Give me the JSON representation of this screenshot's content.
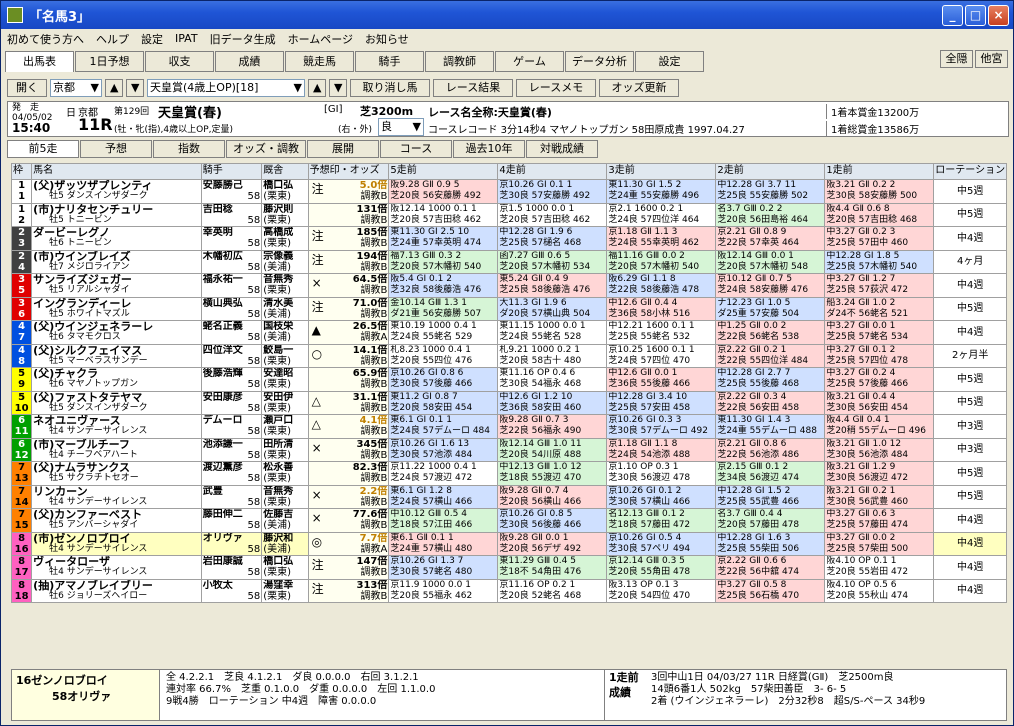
{
  "window": {
    "title": "「名馬3」",
    "controls": [
      "_",
      "□",
      "×"
    ]
  },
  "menu": [
    "初めて使う方へ",
    "ヘルプ",
    "設定",
    "IPAT",
    "旧データ生成",
    "ホームページ",
    "お知らせ"
  ],
  "main_tabs": [
    "出馬表",
    "1日予想",
    "収支",
    "成績",
    "競走馬",
    "騎手",
    "調教師",
    "ゲーム",
    "データ分析",
    "設定"
  ],
  "right_buttons": [
    "全隠",
    "他宮"
  ],
  "controls": {
    "open": "開く",
    "track": "京都",
    "race_select": "天皇賞(4歳上OP)[18]",
    "buttons": [
      "取り消し馬",
      "レース結果",
      "レースメモ",
      "オッズ更新"
    ]
  },
  "race_info": {
    "post_label": "発　走",
    "date": "04/05/02",
    "time": "15:40",
    "day": "日",
    "venue": "京都",
    "round": "11R",
    "meet_no": "第129回",
    "race_name": "天皇賞(春)",
    "conditions": "(牡・牝(指),4歳以上OP,定量)",
    "grade": "[GⅠ]",
    "course": "芝3200m",
    "direction": "(右・外)",
    "going": "良",
    "full_name": "レース名全称:天皇賞(春)",
    "record": "コースレコード 3分14秒4 マヤノトップガン 58田原成貴 1997.04.27",
    "prize1": "1着本賞金13200万",
    "prize2": "1着総賞金13586万"
  },
  "sub_tabs": [
    "前5走",
    "予想",
    "指数",
    "オッズ・調教",
    "展開",
    "コース",
    "過去10年",
    "対戦成績"
  ],
  "headers": [
    "枠",
    "馬名",
    "騎手",
    "厩舎",
    "予想印・オッズ",
    "5走前",
    "4走前",
    "3走前",
    "2走前",
    "1走前",
    "ローテーション"
  ],
  "horses": [
    {
      "waku": "1",
      "no": "1",
      "name": "(父)ザッツザプレンティ",
      "sub": "牡5 ダンスインザダーク",
      "jockey": "安藤勝己",
      "jw": "58",
      "trainer": "橋口弘",
      "loc": "(栗東)",
      "mark": "注",
      "odds": "5.0倍",
      "chokyo": "調教B",
      "rot": "中5週",
      "p5": "阪9.28 GⅡ 0.9 5",
      "p5b": "芝20良 56安藤勝 492",
      "p4": "京10.26 GⅠ 0.1 1",
      "p4b": "芝30良 57安藤勝 492",
      "p3": "東11.30 GⅠ 1.5 2",
      "p3b": "芝24重 55安藤勝 496",
      "p2": "中12.28 GⅠ 3.7 11",
      "p2b": "芝25良 55安藤勝 502",
      "p1": "阪3.21 GⅡ 0.2 2",
      "p1b": "芝30良 58安藤勝 500"
    },
    {
      "waku": "1",
      "no": "2",
      "name": "(市)ナリタセンチュリー",
      "sub": "牡5 トニービン",
      "jockey": "吉田稔",
      "jw": "58",
      "trainer": "藤沢則",
      "loc": "(栗東)",
      "mark": "",
      "odds": "131倍",
      "chokyo": "調教B",
      "rot": "中5週",
      "p5": "阪12.14 1000 0.1 1",
      "p5b": "芝20良 57吉田稔 462",
      "p4": "京1.5 1000 0.0 1",
      "p4b": "芝20良 57吉田稔 462",
      "p3": "京2.1 1600 0.2 1",
      "p3b": "芝24良 57四位洋 464",
      "p2": "名3.7 GⅢ 0.2 2",
      "p2b": "芝20良 56田島裕 464",
      "p1": "阪4.4 GⅡ 0.6 8",
      "p1b": "芝20良 57吉田稔 468"
    },
    {
      "waku": "2",
      "no": "3",
      "name": "ダービーレグノ",
      "sub": "牡6 トニービン",
      "jockey": "幸英明",
      "jw": "58",
      "trainer": "高橋成",
      "loc": "(栗東)",
      "mark": "注",
      "odds": "185倍",
      "chokyo": "調教B",
      "rot": "中4週",
      "p5": "東11.30 GⅠ 2.5 10",
      "p5b": "芝24重 57幸英明 474",
      "p4": "中12.28 GⅠ 1.9 6",
      "p4b": "芝25良 57樋名 468",
      "p3": "京1.18 GⅡ 1.1 3",
      "p3b": "芝24良 55幸英明 462",
      "p2": "京2.21 GⅡ 0.8 9",
      "p2b": "芝22良 57幸英 464",
      "p1": "中3.27 GⅡ 0.2 3",
      "p1b": "芝25良 57田中 460"
    },
    {
      "waku": "2",
      "no": "4",
      "name": "(市)ウインブレイズ",
      "sub": "牡7 メジロライアン",
      "jockey": "木幡初広",
      "jw": "58",
      "trainer": "宗像義",
      "loc": "(美浦)",
      "mark": "注",
      "odds": "194倍",
      "chokyo": "調教B",
      "rot": "4ヶ月",
      "p5": "福7.13 GⅢ 0.3 2",
      "p5b": "芝20良 57木幡初 540",
      "p4": "函7.27 GⅢ 0.6 5",
      "p4b": "芝20良 57木幡初 534",
      "p3": "福11.16 GⅢ 0.0 2",
      "p3b": "芝20良 57木幡初 540",
      "p2": "阪12.14 GⅢ 0.0 1",
      "p2b": "芝20良 57木幡初 548",
      "p1": "中12.28 GⅠ 1.8 5",
      "p1b": "芝25良 57木幡初 540"
    },
    {
      "waku": "3",
      "no": "5",
      "name": "サンライズジェガー",
      "sub": "牡5 リアルシャダイ",
      "jockey": "福永祐一",
      "jw": "58",
      "trainer": "音無秀",
      "loc": "(栗東)",
      "mark": "×",
      "odds": "64.5倍",
      "chokyo": "調教B",
      "rot": "中4週",
      "p5": "阪5.4 GⅠ 0.1 2",
      "p5b": "芝32良 58後藤浩 476",
      "p4": "東5.24 GⅡ 0.4 9",
      "p4b": "芝25良 58後藤浩 476",
      "p3": "阪6.29 GⅠ 1.1 8",
      "p3b": "芝22良 58後藤浩 478",
      "p2": "京10.12 GⅡ 0.7 5",
      "p2b": "芝24良 58安藤勝 476",
      "p1": "中3.27 GⅡ 1.2 7",
      "p1b": "芝25良 57荻沢 472"
    },
    {
      "waku": "3",
      "no": "6",
      "name": "イングランディーレ",
      "sub": "牡5 ホワイトマズル",
      "jockey": "横山典弘",
      "jw": "58",
      "trainer": "清水美",
      "loc": "(美浦)",
      "mark": "注",
      "odds": "71.0倍",
      "chokyo": "調教B",
      "rot": "中5週",
      "p5": "金10.14 GⅢ 1.3 1",
      "p5b": "ダ21重 56安藤勝 507",
      "p4": "大11.3 GⅠ 1.9 6",
      "p4b": "ダ20良 57横山典 504",
      "p3": "中12.6 GⅡ 0.4 4",
      "p3b": "芝36良 58小林 516",
      "p2": "ナ12.23 GⅠ 1.0 5",
      "p2b": "ダ25重 57安藤 504",
      "p1": "船3.24 GⅡ 1.0 2",
      "p1b": "ダ24不 56蛯名 521"
    },
    {
      "waku": "4",
      "no": "7",
      "name": "(父)ウインジェネラーレ",
      "sub": "牡6 タマモクロス",
      "jockey": "蛯名正義",
      "jw": "58",
      "trainer": "国枝栄",
      "loc": "(美浦)",
      "mark": "▲",
      "odds": "26.5倍",
      "chokyo": "調教A",
      "rot": "中4週",
      "p5": "東10.19 1000 0.4 1",
      "p5b": "芝24良 55蛯名 529",
      "p4": "東11.15 1000 0.0 1",
      "p4b": "芝24良 55蛯名 528",
      "p3": "中12.21 1600 0.1 1",
      "p3b": "芝25良 55蛯名 532",
      "p2": "中1.25 GⅡ 0.0 2",
      "p2b": "芝22良 56蛯名 538",
      "p1": "中3.27 GⅡ 0.0 1",
      "p1b": "芝25良 57蛯名 534"
    },
    {
      "waku": "4",
      "no": "8",
      "name": "(父)シルクフェイマス",
      "sub": "牡5 マーベラスサンデー",
      "jockey": "四位洋文",
      "jw": "58",
      "trainer": "鮫島一",
      "loc": "(栗東)",
      "mark": "○",
      "odds": "14.1倍",
      "chokyo": "調教B",
      "rot": "2ヶ月半",
      "p5": "札8.23 1000 0.4 1",
      "p5b": "芝20良 55四位 476",
      "p4": "札9.21 1000 0.2 1",
      "p4b": "芝20良 58古十 480",
      "p3": "京10.25 1600 0.1 1",
      "p3b": "芝24良 57四位 470",
      "p2": "京2.22 GⅡ 0.2 1",
      "p2b": "芝22良 55四位洋 484",
      "p1": "中3.27 GⅡ 0.1 2",
      "p1b": "芝25良 57四位 478"
    },
    {
      "waku": "5",
      "no": "9",
      "name": "(父)チャクラ",
      "sub": "牡6 マヤノトップガン",
      "jockey": "後藤浩輝",
      "jw": "58",
      "trainer": "安達昭",
      "loc": "(栗東)",
      "mark": "",
      "odds": "65.9倍",
      "chokyo": "調教B",
      "rot": "中5週",
      "p5": "京10.26 GⅠ 0.8 6",
      "p5b": "芝30良 57後藤 466",
      "p4": "東11.16 OP 0.4 6",
      "p4b": "芝30良 54福永 468",
      "p3": "中12.6 GⅡ 0.0 1",
      "p3b": "芝36良 55後藤 466",
      "p2": "中12.28 GⅠ 2.7 7",
      "p2b": "芝25良 55後藤 468",
      "p1": "中3.27 GⅡ 0.2 4",
      "p1b": "芝25良 57後藤 466"
    },
    {
      "waku": "5",
      "no": "10",
      "name": "(父)ファストタテヤマ",
      "sub": "牡5 ダンスインザダーク",
      "jockey": "安田康彦",
      "jw": "58",
      "trainer": "安田伊",
      "loc": "(栗東)",
      "mark": "△",
      "odds": "31.1倍",
      "chokyo": "調教B",
      "rot": "中5週",
      "p5": "東11.2 GⅠ 0.8 7",
      "p5b": "芝20良 58安田 454",
      "p4": "中12.6 GⅠ 1.2 10",
      "p4b": "芝36良 58安田 460",
      "p3": "中12.28 GⅠ 3.4 10",
      "p3b": "芝25良 57安田 458",
      "p2": "京2.22 GⅡ 0.3 4",
      "p2b": "芝22良 56安田 458",
      "p1": "阪3.21 GⅡ 0.4 4",
      "p1b": "芝30良 56安田 454"
    },
    {
      "waku": "6",
      "no": "11",
      "name": "ネオユニヴァース",
      "sub": "牡4 サンデーサイレンス",
      "jockey": "デムーロ",
      "jw": "58",
      "trainer": "瀬戸口",
      "loc": "(栗東)",
      "mark": "△",
      "odds": "4.1倍",
      "chokyo": "調教B",
      "rot": "中3週",
      "p5": "東6.1 GⅠ 0.1 1",
      "p5b": "芝24良 57デムーロ 484",
      "p4": "阪9.28 GⅡ 0.7 3",
      "p4b": "芝22良 56福永 490",
      "p3": "京10.26 GⅠ 0.3 3",
      "p3b": "芝30良 57デムーロ 492",
      "p2": "東11.30 GⅠ 1.4 3",
      "p2b": "芝24重 55デムーロ 488",
      "p1": "阪4.4 GⅡ 0.4 1",
      "p1b": "芝20稍 55デムーロ 496"
    },
    {
      "waku": "6",
      "no": "12",
      "name": "(市)マーブルチーフ",
      "sub": "牡4 チーフベアハート",
      "jockey": "池添謙一",
      "jw": "58",
      "trainer": "田所清",
      "loc": "(栗東)",
      "mark": "×",
      "odds": "345倍",
      "chokyo": "調教B",
      "rot": "中3週",
      "p5": "京10.26 GⅠ 1.6 13",
      "p5b": "芝30良 57池添 484",
      "p4": "阪12.14 GⅢ 1.0 11",
      "p4b": "芝20良 54川原 488",
      "p3": "京1.18 GⅡ 1.1 8",
      "p3b": "芝24良 54池添 488",
      "p2": "京2.21 GⅡ 0.8 6",
      "p2b": "芝22良 56池添 486",
      "p1": "阪3.21 GⅡ 1.0 12",
      "p1b": "芝30良 56池添 484"
    },
    {
      "waku": "7",
      "no": "13",
      "name": "(父)ナムラサンクス",
      "sub": "牡5 サクラチトセオー",
      "jockey": "渡辺薫彦",
      "jw": "58",
      "trainer": "松永善",
      "loc": "(栗東)",
      "mark": "",
      "odds": "82.3倍",
      "chokyo": "調教B",
      "rot": "中5週",
      "p5": "京11.22 1000 0.4 1",
      "p5b": "芝24良 57渡辺 472",
      "p4": "中12.13 GⅢ 1.0 12",
      "p4b": "芝18良 55渡辺 470",
      "p3": "京1.10 OP 0.3 1",
      "p3b": "芝30良 56渡辺 478",
      "p2": "京2.15 GⅢ 0.1 2",
      "p2b": "芝34良 56渡辺 474",
      "p1": "阪3.21 GⅡ 1.2 9",
      "p1b": "芝30良 56渡辺 472"
    },
    {
      "waku": "7",
      "no": "14",
      "name": "リンカーン",
      "sub": "牡4 サンデーサイレンス",
      "jockey": "武豊",
      "jw": "58",
      "trainer": "音無秀",
      "loc": "(栗東)",
      "mark": "×",
      "odds": "2.2倍",
      "chokyo": "調教B",
      "rot": "中5週",
      "p5": "東6.1 GⅠ 1.2 8",
      "p5b": "芝24良 57横山 466",
      "p4": "阪9.28 GⅡ 0.7 4",
      "p4b": "芝20良 56横山 466",
      "p3": "京10.26 GⅠ 0.1 2",
      "p3b": "芝30良 57横山 466",
      "p2": "中12.28 GⅠ 1.5 2",
      "p2b": "芝25良 55武豊 466",
      "p1": "阪3.21 GⅡ 0.2 1",
      "p1b": "芝30良 56武豊 460"
    },
    {
      "waku": "7",
      "no": "15",
      "name": "(父)カンファーベスト",
      "sub": "牡5 アンバーシャダイ",
      "jockey": "藤田伸二",
      "jw": "58",
      "trainer": "佐藤吉",
      "loc": "(美浦)",
      "mark": "×",
      "odds": "77.6倍",
      "chokyo": "調教B",
      "rot": "中4週",
      "p5": "中10.12 GⅢ 0.5 4",
      "p5b": "芝18良 57江田 466",
      "p4": "京10.26 GⅠ 0.8 5",
      "p4b": "芝30良 56後藤 466",
      "p3": "名12.13 GⅢ 0.1 2",
      "p3b": "芝18良 57藤田 472",
      "p2": "名3.7 GⅢ 0.4 4",
      "p2b": "芝20良 57藤田 478",
      "p1": "中3.27 GⅡ 0.6 3",
      "p1b": "芝25良 57藤田 474"
    },
    {
      "waku": "8",
      "no": "16",
      "name": "(市)ゼンノロブロイ",
      "sub": "牡4 サンデーサイレンス",
      "jockey": "オリヴァ",
      "jw": "58",
      "trainer": "藤沢和",
      "loc": "(美浦)",
      "mark": "◎",
      "odds": "7.7倍",
      "chokyo": "調教A",
      "rot": "中4週",
      "p5": "東6.1 GⅡ 0.1 1",
      "p5b": "芝24重 57横山 480",
      "p4": "阪9.28 GⅡ 0.0 1",
      "p4b": "芝20良 56デザ 492",
      "p3": "京10.26 GⅠ 0.5 4",
      "p3b": "芝30良 57ペリ 494",
      "p2": "中12.28 GⅠ 1.6 3",
      "p2b": "芝25良 55柴田 506",
      "p1": "中3.27 GⅡ 0.0 2",
      "p1b": "芝25良 57柴田 500"
    },
    {
      "waku": "8",
      "no": "17",
      "name": "ヴィータローザ",
      "sub": "牡4 サンデーサイレンス",
      "jockey": "岩田康誠",
      "jw": "58",
      "trainer": "橋口弘",
      "loc": "(栗東)",
      "mark": "注",
      "odds": "147倍",
      "chokyo": "調教B",
      "rot": "中4週",
      "p5": "京10.26 GⅠ 1.3 7",
      "p5b": "芝30良 57蛯名 480",
      "p4": "東11.29 GⅢ 0.4 5",
      "p4b": "芝18不 54角田 476",
      "p3": "京12.14 GⅢ 0.3 5",
      "p3b": "芝20良 55角田 478",
      "p2": "京2.22 GⅡ 0.6 6",
      "p2b": "芝22良 56中舘 474",
      "p1": "阪4.10 OP 0.1 1",
      "p1b": "芝20良 55岩田 472"
    },
    {
      "waku": "8",
      "no": "18",
      "name": "(抽)アマノブレイブリー",
      "sub": "牡6 ジョリーズヘイロー",
      "jockey": "小牧太",
      "jw": "58",
      "trainer": "湯窪幸",
      "loc": "(栗東)",
      "mark": "注",
      "odds": "313倍",
      "chokyo": "調教B",
      "rot": "中4週",
      "p5": "京11.9 1000 0.0 1",
      "p5b": "芝20良 55福永 462",
      "p4": "京11.16 OP 0.2 1",
      "p4b": "芝20良 52蛯名 468",
      "p3": "阪3.13 OP 0.1 3",
      "p3b": "芝20良 54四位 470",
      "p2": "中3.27 GⅡ 0.5 8",
      "p2b": "芝25良 56石橋 470",
      "p1": "阪4.10 OP 0.5 6",
      "p1b": "芝20良 55秋山 474"
    }
  ],
  "waku_colors": {
    "1": "#ffffff",
    "2": "#404040",
    "3": "#e00000",
    "4": "#0050e0",
    "5": "#ffff00",
    "6": "#00a000",
    "7": "#ff8000",
    "8": "#ff60c0"
  },
  "bottom": {
    "horse": "16ゼンノロブロイ",
    "jockey": "58オリヴァ",
    "stats1": "全 4.2.2.1　芝良 4.1.2.1　ダ良 0.0.0.0　右回 3.1.2.1",
    "stats2": "連対率 66.7%　芝重 0.1.0.0　ダ重 0.0.0.0　左回 1.1.0.0",
    "stats3": "9戦4勝　ローテーション 中4週　障害 0.0.0.0",
    "result_label1": "1走前",
    "result_label2": "成績",
    "result1": "3回中山1日 04/03/27 11R 日経賞(GⅡ)　芝2500m良",
    "result2": "14頭6番1人 502kg　57柴田善臣　3- 6- 5",
    "result3": "2着 (ウインジェネラーレ)　2分32秒8　超S/S-ペース 34秒9"
  }
}
